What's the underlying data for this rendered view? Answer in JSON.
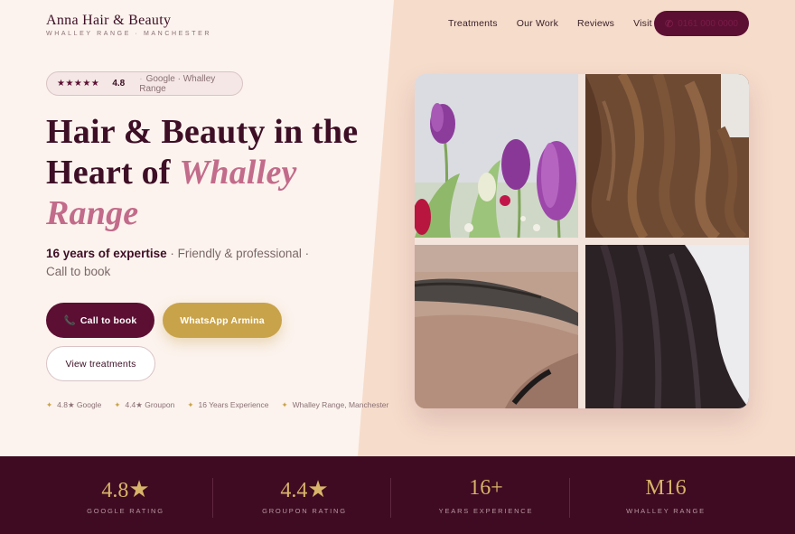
{
  "brand": {
    "name": "Anna Hair & Beauty",
    "sub": "WHALLEY RANGE · MANCHESTER"
  },
  "nav": {
    "items": [
      "Treatments",
      "Our Work",
      "Reviews",
      "Visit"
    ],
    "call_icon": "phone-icon",
    "call_label": "0161 000 0000"
  },
  "rating": {
    "stars": "★★★★★",
    "score": "4.8",
    "source": "Google · Whalley Range"
  },
  "hero": {
    "headline_plain": "Hair & Beauty in the Heart of ",
    "headline_accent": "Whalley Range",
    "sub_strong": "16 years of expertise",
    "sub_rest": " · Friendly & professional · Call to book"
  },
  "buttons": {
    "call": "Call to book",
    "call_icon": "📞",
    "whatsapp": "WhatsApp Armina",
    "view": "View treatments"
  },
  "badges": [
    "4.8★ Google",
    "4.4★ Groupon",
    "16 Years Experience",
    "Whalley Range, Manchester"
  ],
  "badge_icon": "✦",
  "gallery": [
    {
      "subject": "purple tulips bouquet"
    },
    {
      "subject": "brown wavy hair"
    },
    {
      "subject": "eyebrow close-up"
    },
    {
      "subject": "dark straight hair"
    }
  ],
  "stats": [
    {
      "value": "4.8",
      "star": "★",
      "label": "GOOGLE RATING"
    },
    {
      "value": "4.4",
      "star": "★",
      "label": "GROUPON RATING"
    },
    {
      "value": "16+",
      "star": "",
      "label": "YEARS EXPERIENCE"
    },
    {
      "value": "M16",
      "star": "",
      "label": "WHALLEY RANGE"
    }
  ],
  "colors": {
    "plum": "#5c0f33",
    "deep_plum": "#3e0b22",
    "gold": "#c9a34a",
    "rose": "#c26b8a",
    "cream": "#fcf3ee",
    "peach": "#f6dccb"
  }
}
